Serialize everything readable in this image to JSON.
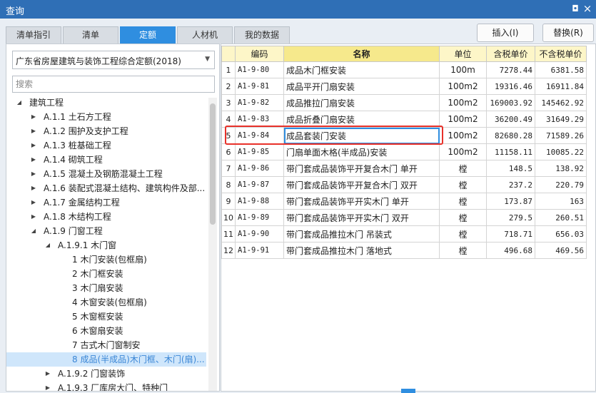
{
  "window": {
    "title": "查询",
    "restore_glyph": "◘",
    "close_glyph": "×"
  },
  "tabs": [
    {
      "label": "清单指引",
      "active": false
    },
    {
      "label": "清单",
      "active": false
    },
    {
      "label": "定额",
      "active": true
    },
    {
      "label": "人材机",
      "active": false
    },
    {
      "label": "我的数据",
      "active": false
    }
  ],
  "actions": {
    "insert_label": "插入(I)",
    "replace_label": "替换(R)"
  },
  "left": {
    "dropdown_value": "广东省房屋建筑与装饰工程综合定额(2018)",
    "search_placeholder": "搜索",
    "tree": [
      {
        "label": "建筑工程",
        "caret": "◢",
        "level": 0
      },
      {
        "label": "A.1.1 土石方工程",
        "caret": "▶",
        "level": 1
      },
      {
        "label": "A.1.2 围护及支护工程",
        "caret": "▶",
        "level": 1
      },
      {
        "label": "A.1.3 桩基础工程",
        "caret": "▶",
        "level": 1
      },
      {
        "label": "A.1.4 砌筑工程",
        "caret": "▶",
        "level": 1
      },
      {
        "label": "A.1.5 混凝土及钢筋混凝土工程",
        "caret": "▶",
        "level": 1
      },
      {
        "label": "A.1.6 装配式混凝土结构、建筑构件及部...",
        "caret": "▶",
        "level": 1
      },
      {
        "label": "A.1.7 金属结构工程",
        "caret": "▶",
        "level": 1
      },
      {
        "label": "A.1.8 木结构工程",
        "caret": "▶",
        "level": 1
      },
      {
        "label": "A.1.9 门窗工程",
        "caret": "◢",
        "level": 1
      },
      {
        "label": "A.1.9.1 木门窗",
        "caret": "◢",
        "level": 2
      },
      {
        "label": "1 木门安装(包框扇)",
        "caret": "",
        "level": 3
      },
      {
        "label": "2 木门框安装",
        "caret": "",
        "level": 3
      },
      {
        "label": "3 木门扇安装",
        "caret": "",
        "level": 3
      },
      {
        "label": "4 木窗安装(包框扇)",
        "caret": "",
        "level": 3
      },
      {
        "label": "5 木窗框安装",
        "caret": "",
        "level": 3
      },
      {
        "label": "6 木窗扇安装",
        "caret": "",
        "level": 3
      },
      {
        "label": "7 古式木门窗制安",
        "caret": "",
        "level": 3
      },
      {
        "label": "8 成品(半成品)木门框、木门(扇)...",
        "caret": "",
        "level": 3,
        "selected": true
      },
      {
        "label": "A.1.9.2 门窗装饰",
        "caret": "▶",
        "level": 2
      },
      {
        "label": "A.1.9.3 厂库房大门、特种门",
        "caret": "▶",
        "level": 2
      }
    ]
  },
  "table": {
    "headers": [
      "",
      "编码",
      "名称",
      "单位",
      "含税单价",
      "不含税单价"
    ],
    "rows": [
      {
        "idx": "1",
        "code": "A1-9-80",
        "name": "成品木门框安装",
        "unit": "100m",
        "price_tax": "7278.44",
        "price_notax": "6381.58"
      },
      {
        "idx": "2",
        "code": "A1-9-81",
        "name": "成品平开门扇安装",
        "unit": "100m2",
        "price_tax": "19316.46",
        "price_notax": "16911.84"
      },
      {
        "idx": "3",
        "code": "A1-9-82",
        "name": "成品推拉门扇安装",
        "unit": "100m2",
        "price_tax": "169003.92",
        "price_notax": "145462.92"
      },
      {
        "idx": "4",
        "code": "A1-9-83",
        "name": "成品折叠门扇安装",
        "unit": "100m2",
        "price_tax": "36200.49",
        "price_notax": "31649.29"
      },
      {
        "idx": "5",
        "code": "A1-9-84",
        "name": "成品套装门安装",
        "unit": "100m2",
        "price_tax": "82680.28",
        "price_notax": "71589.26",
        "selected": true
      },
      {
        "idx": "6",
        "code": "A1-9-85",
        "name": "门扇单面木格(半成品)安装",
        "unit": "100m2",
        "price_tax": "11158.11",
        "price_notax": "10085.22"
      },
      {
        "idx": "7",
        "code": "A1-9-86",
        "name": "带门套成品装饰平开复合木门 单开",
        "unit": "樘",
        "price_tax": "148.5",
        "price_notax": "138.92"
      },
      {
        "idx": "8",
        "code": "A1-9-87",
        "name": "带门套成品装饰平开复合木门 双开",
        "unit": "樘",
        "price_tax": "237.2",
        "price_notax": "220.79"
      },
      {
        "idx": "9",
        "code": "A1-9-88",
        "name": "带门套成品装饰平开实木门 单开",
        "unit": "樘",
        "price_tax": "173.87",
        "price_notax": "163"
      },
      {
        "idx": "10",
        "code": "A1-9-89",
        "name": "带门套成品装饰平开实木门 双开",
        "unit": "樘",
        "price_tax": "279.5",
        "price_notax": "260.51"
      },
      {
        "idx": "11",
        "code": "A1-9-90",
        "name": "带门套成品推拉木门 吊装式",
        "unit": "樘",
        "price_tax": "718.71",
        "price_notax": "656.03"
      },
      {
        "idx": "12",
        "code": "A1-9-91",
        "name": "带门套成品推拉木门 落地式",
        "unit": "樘",
        "price_tax": "496.68",
        "price_notax": "469.56"
      }
    ]
  }
}
